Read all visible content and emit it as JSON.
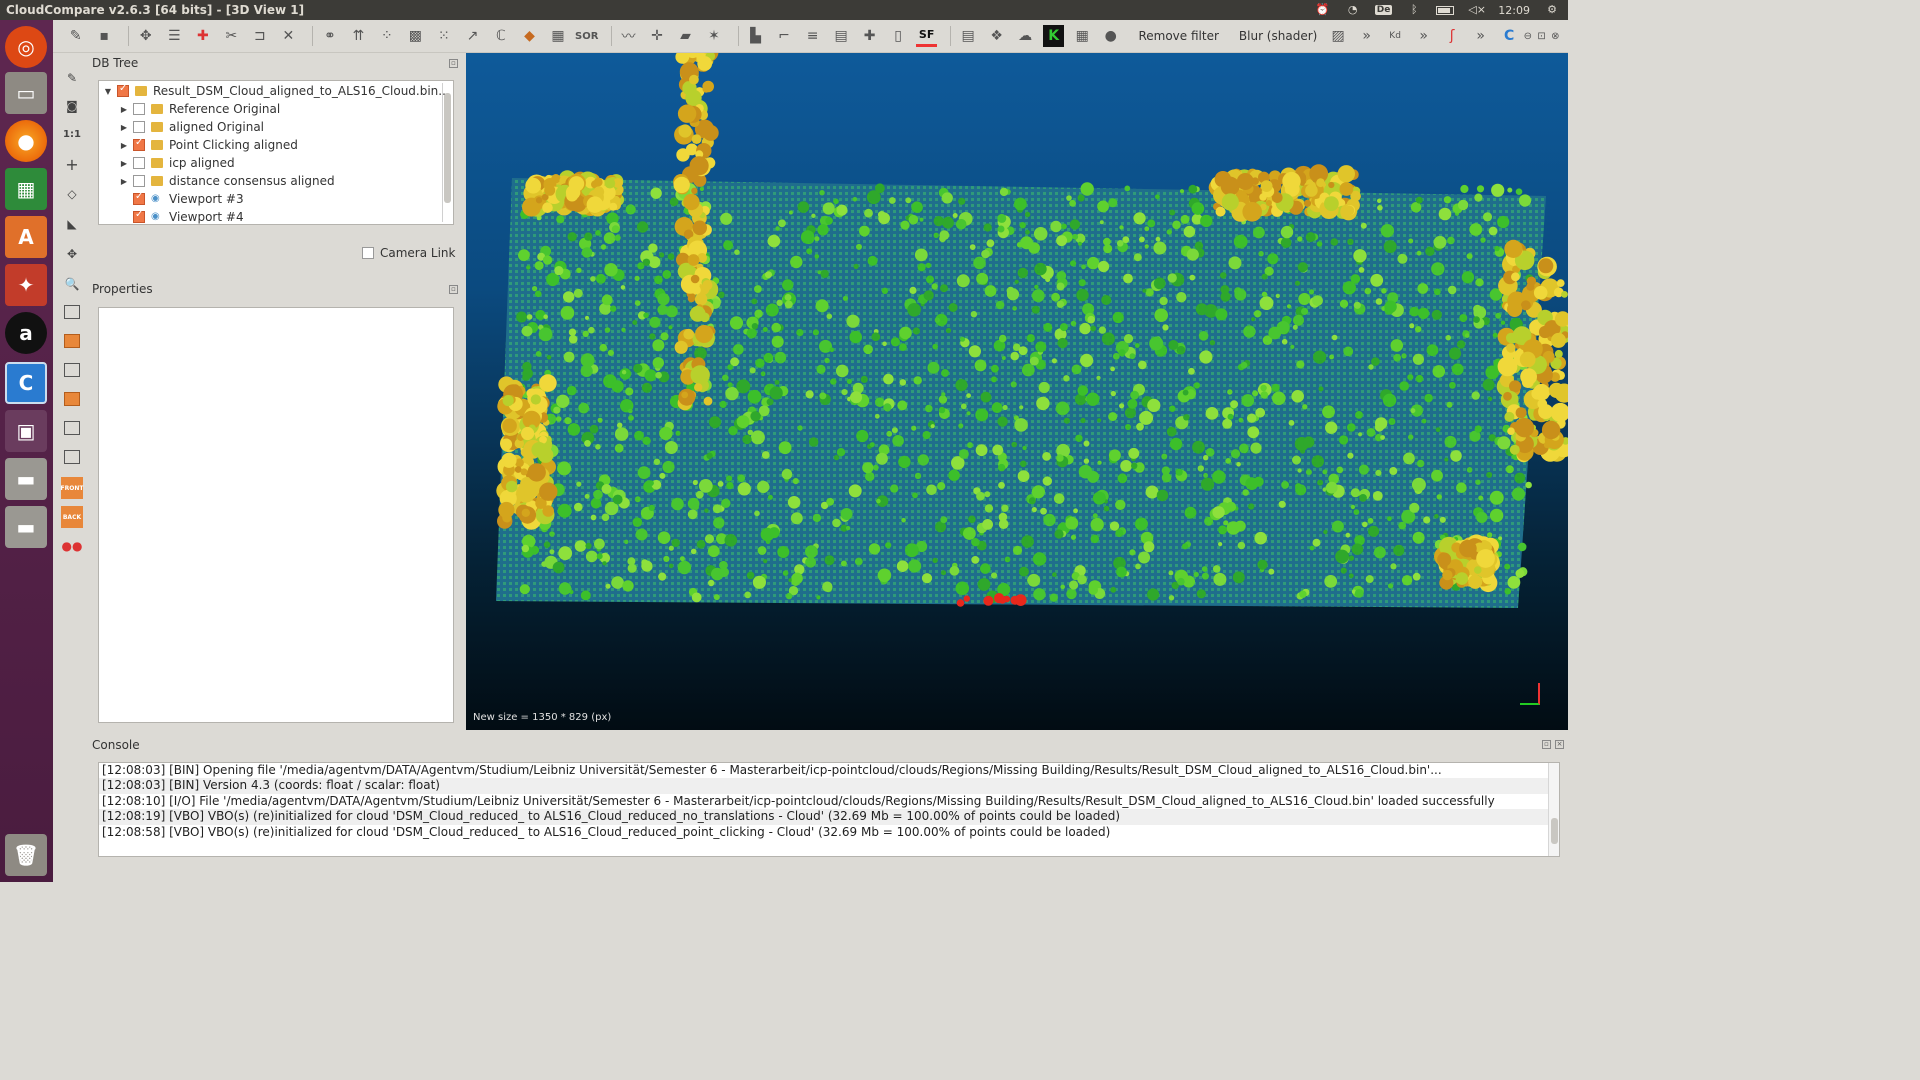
{
  "window": {
    "title": "CloudCompare v2.6.3 [64 bits] - [3D View 1]"
  },
  "system": {
    "keyboard_layout": "De",
    "time": "12:09"
  },
  "toolbar": {
    "remove_filter_label": "Remove filter",
    "blur_label": "Blur (shader)",
    "sf_label": "SF",
    "sor_label": "SOR",
    "kd_label": "Kd",
    "overflow_label": "»"
  },
  "left_tools": {
    "one_to_one_label": "1:1",
    "front_label": "FRONT",
    "back_label": "BACK"
  },
  "db_tree": {
    "title": "DB Tree",
    "root": {
      "label": "Result_DSM_Cloud_aligned_to_ALS16_Cloud.bin...",
      "checked": true
    },
    "items": [
      {
        "label": "Reference Original",
        "checked": false,
        "type": "folder"
      },
      {
        "label": "aligned Original",
        "checked": false,
        "type": "folder"
      },
      {
        "label": "Point Clicking aligned",
        "checked": true,
        "type": "folder"
      },
      {
        "label": "icp aligned",
        "checked": false,
        "type": "folder"
      },
      {
        "label": "distance consensus aligned",
        "checked": false,
        "type": "folder"
      },
      {
        "label": "Viewport #3",
        "checked": true,
        "type": "viewport"
      },
      {
        "label": "Viewport #4",
        "checked": true,
        "type": "viewport"
      }
    ]
  },
  "camera_link": {
    "label": "Camera Link",
    "checked": false
  },
  "properties": {
    "title": "Properties"
  },
  "view3d": {
    "status_text": "New size = 1350 * 829 (px)"
  },
  "console": {
    "title": "Console",
    "lines": [
      "[12:08:03] [BIN] Opening file '/media/agentvm/DATA/Agentvm/Studium/Leibniz Universität/Semester 6 - Masterarbeit/icp-pointcloud/clouds/Regions/Missing Building/Results/Result_DSM_Cloud_aligned_to_ALS16_Cloud.bin'...",
      "[12:08:03] [BIN] Version 4.3 (coords: float / scalar: float)",
      "[12:08:10] [I/O] File '/media/agentvm/DATA/Agentvm/Studium/Leibniz Universität/Semester 6 - Masterarbeit/icp-pointcloud/clouds/Regions/Missing Building/Results/Result_DSM_Cloud_aligned_to_ALS16_Cloud.bin' loaded successfully",
      "[12:08:19] [VBO] VBO(s) (re)initialized for cloud 'DSM_Cloud_reduced_ to ALS16_Cloud_reduced_no_translations - Cloud' (32.69 Mb = 100.00% of points could be loaded)",
      "[12:08:58] [VBO] VBO(s) (re)initialized for cloud 'DSM_Cloud_reduced_ to ALS16_Cloud_reduced_point_clicking - Cloud' (32.69 Mb = 100.00% of points could be loaded)"
    ]
  },
  "colors": {
    "checkbox_on": "#f07746",
    "folder": "#e4b53e",
    "launcher_bg": "#5e2750",
    "view_bg_top": "#0e5a9a"
  }
}
